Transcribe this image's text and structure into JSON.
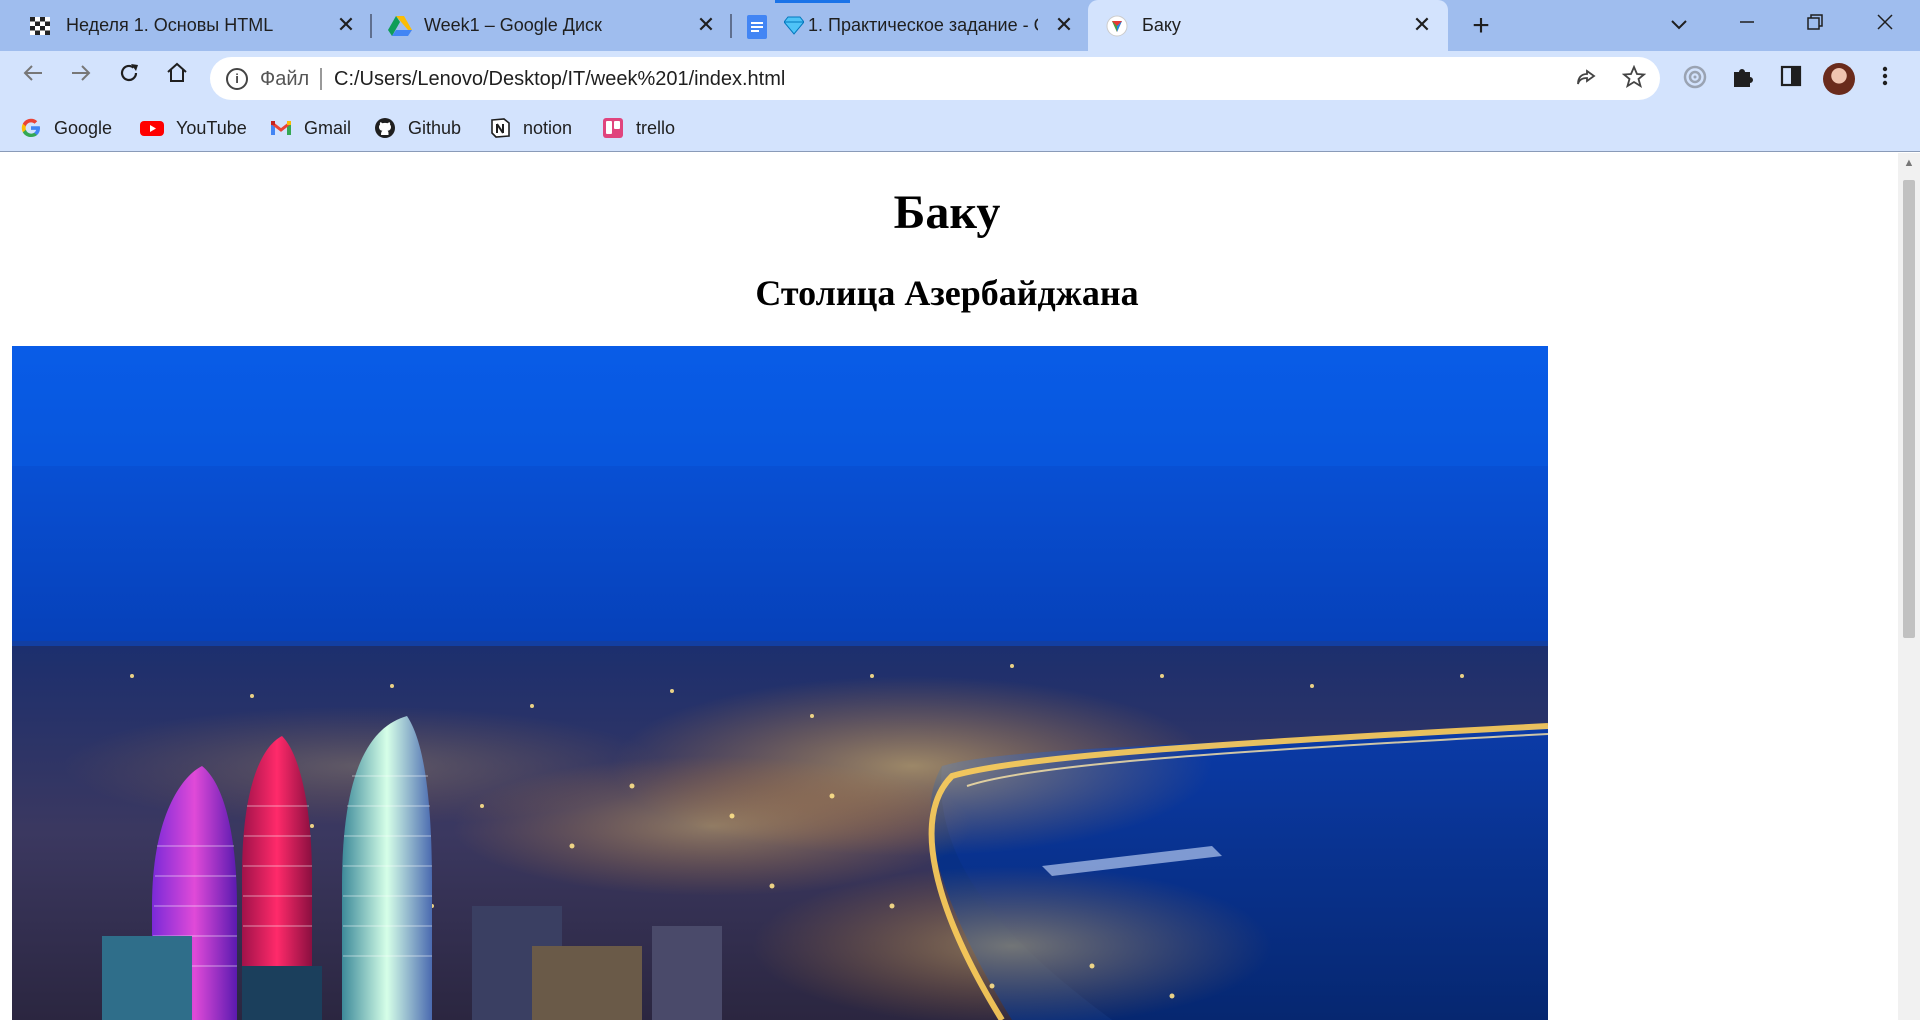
{
  "tabs": [
    {
      "title": "Неделя 1. Основы HTML",
      "icon": "checkered-flag-icon"
    },
    {
      "title": "Week1 – Google Диск",
      "icon": "google-drive-icon"
    },
    {
      "title": "1. Практическое задание - G",
      "icon": "google-docs-icon"
    },
    {
      "title": "Баку",
      "icon": "page-favicon-icon",
      "active": true
    }
  ],
  "toolbar": {
    "file_label": "Файл",
    "url": "C:/Users/Lenovo/Desktop/IT/week%201/index.html"
  },
  "bookmarks": [
    {
      "label": "Google",
      "icon": "google-icon"
    },
    {
      "label": "YouTube",
      "icon": "youtube-icon"
    },
    {
      "label": "Gmail",
      "icon": "gmail-icon"
    },
    {
      "label": "Github",
      "icon": "github-icon"
    },
    {
      "label": "notion",
      "icon": "notion-icon"
    },
    {
      "label": "trello",
      "icon": "trello-icon"
    }
  ],
  "page": {
    "heading": "Баку",
    "subheading": "Столица Азербайджана",
    "image_subject": "baku-night-cityscape"
  },
  "colors": {
    "tab_strip": "#9fbdee",
    "toolbar": "#d3e3fd",
    "sky_top": "#0a55e0",
    "sky_bottom": "#052a8a"
  }
}
